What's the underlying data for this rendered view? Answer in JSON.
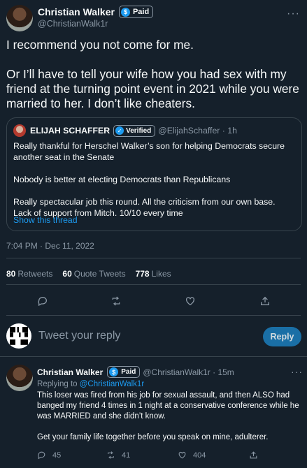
{
  "main_tweet": {
    "author_name": "Christian Walker",
    "badge_label": "Paid",
    "handle": "@ChristianWalk1r",
    "more_label": "···",
    "paragraphs": [
      "I recommend you not come for me.",
      "Or I’ll have to tell your wife how you had sex with my friend at the turning point event in 2021 while you were married to her. I don’t like cheaters."
    ],
    "timestamp": "7:04 PM · Dec 11, 2022"
  },
  "quoted_tweet": {
    "author_name": "ELIJAH SCHAFFER",
    "badge_label": "Verified",
    "meta": "@ElijahSchaffer · 1h",
    "paragraphs": [
      "Really thankful for Herschel Walker’s son for helping Democrats secure another seat in the Senate",
      "Nobody is better at electing Democrats than Republicans",
      "Really spectacular job this round. All the criticism from our own base. Lack of support from Mitch. 10/10 every time"
    ],
    "show_thread": "Show this thread"
  },
  "stats": {
    "retweets_count": "80",
    "retweets_label": "Retweets",
    "quotes_count": "60",
    "quotes_label": "Quote Tweets",
    "likes_count": "778",
    "likes_label": "Likes"
  },
  "composer": {
    "placeholder": "Tweet your reply",
    "button_label": "Reply"
  },
  "reply_tweet": {
    "author_name": "Christian Walker",
    "badge_label": "Paid",
    "meta": "@ChristianWalk1r · 15m",
    "more_label": "···",
    "replying_prefix": "Replying to",
    "replying_handle": "@ChristianWalk1r",
    "paragraphs": [
      "This loser was fired from his job for sexual assault, and then ALSO had banged my friend 4 times in 1 night at a conservative conference while he was MARRIED and she didn’t know.",
      "Get your family life together before you speak on mine, adulterer."
    ],
    "reply_count": "45",
    "retweet_count": "41",
    "like_count": "404"
  },
  "icons": {
    "reply": "reply-icon",
    "retweet": "retweet-icon",
    "like": "heart-icon",
    "share": "share-icon"
  },
  "colors": {
    "background": "#15202b",
    "accent": "#1d9bf0",
    "muted": "#8b98a5",
    "border": "#38444d"
  }
}
